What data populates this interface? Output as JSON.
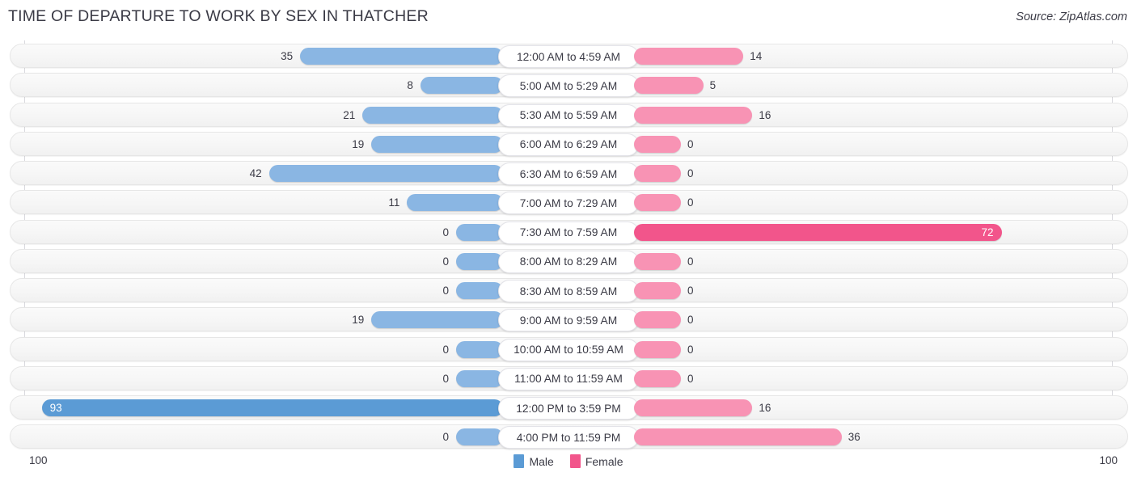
{
  "header": {
    "title": "TIME OF DEPARTURE TO WORK BY SEX IN THATCHER",
    "source": "Source: ZipAtlas.com"
  },
  "legend": {
    "male_label": "Male",
    "female_label": "Female",
    "male_color": "#5b9bd5",
    "female_color": "#f2558b"
  },
  "axis": {
    "left_max": "100",
    "right_max": "100"
  },
  "colors": {
    "male": "#8ab6e3",
    "male_highlight": "#5b9bd5",
    "female": "#f893b4",
    "female_highlight": "#f2558b",
    "track": "#f5f5f5",
    "gridline": "#d9d9de"
  },
  "chart_data": {
    "type": "bar",
    "title": "TIME OF DEPARTURE TO WORK BY SEX IN THATCHER",
    "orientation": "horizontal-diverging",
    "xlabel": "",
    "ylabel": "",
    "xlim": [
      100,
      100
    ],
    "grid": true,
    "legend_position": "bottom-center",
    "categories": [
      "12:00 AM to 4:59 AM",
      "5:00 AM to 5:29 AM",
      "5:30 AM to 5:59 AM",
      "6:00 AM to 6:29 AM",
      "6:30 AM to 6:59 AM",
      "7:00 AM to 7:29 AM",
      "7:30 AM to 7:59 AM",
      "8:00 AM to 8:29 AM",
      "8:30 AM to 8:59 AM",
      "9:00 AM to 9:59 AM",
      "10:00 AM to 10:59 AM",
      "11:00 AM to 11:59 AM",
      "12:00 PM to 3:59 PM",
      "4:00 PM to 11:59 PM"
    ],
    "series": [
      {
        "name": "Male",
        "direction": "left",
        "color": "#8ab6e3",
        "values": [
          35,
          8,
          21,
          19,
          42,
          11,
          0,
          0,
          0,
          19,
          0,
          0,
          93,
          0
        ]
      },
      {
        "name": "Female",
        "direction": "right",
        "color": "#f893b4",
        "values": [
          14,
          5,
          16,
          0,
          0,
          0,
          72,
          0,
          0,
          0,
          0,
          0,
          16,
          36
        ]
      }
    ]
  },
  "rows": [
    {
      "label": "12:00 AM to 4:59 AM",
      "male": 35,
      "female": 14,
      "male_text": "35",
      "female_text": "14"
    },
    {
      "label": "5:00 AM to 5:29 AM",
      "male": 8,
      "female": 5,
      "male_text": "8",
      "female_text": "5"
    },
    {
      "label": "5:30 AM to 5:59 AM",
      "male": 21,
      "female": 16,
      "male_text": "21",
      "female_text": "16"
    },
    {
      "label": "6:00 AM to 6:29 AM",
      "male": 19,
      "female": 0,
      "male_text": "19",
      "female_text": "0"
    },
    {
      "label": "6:30 AM to 6:59 AM",
      "male": 42,
      "female": 0,
      "male_text": "42",
      "female_text": "0"
    },
    {
      "label": "7:00 AM to 7:29 AM",
      "male": 11,
      "female": 0,
      "male_text": "11",
      "female_text": "0"
    },
    {
      "label": "7:30 AM to 7:59 AM",
      "male": 0,
      "female": 72,
      "male_text": "0",
      "female_text": "72"
    },
    {
      "label": "8:00 AM to 8:29 AM",
      "male": 0,
      "female": 0,
      "male_text": "0",
      "female_text": "0"
    },
    {
      "label": "8:30 AM to 8:59 AM",
      "male": 0,
      "female": 0,
      "male_text": "0",
      "female_text": "0"
    },
    {
      "label": "9:00 AM to 9:59 AM",
      "male": 19,
      "female": 0,
      "male_text": "19",
      "female_text": "0"
    },
    {
      "label": "10:00 AM to 10:59 AM",
      "male": 0,
      "female": 0,
      "male_text": "0",
      "female_text": "0"
    },
    {
      "label": "11:00 AM to 11:59 AM",
      "male": 0,
      "female": 0,
      "male_text": "0",
      "female_text": "0"
    },
    {
      "label": "12:00 PM to 3:59 PM",
      "male": 93,
      "female": 16,
      "male_text": "93",
      "female_text": "16"
    },
    {
      "label": "4:00 PM to 11:59 PM",
      "male": 0,
      "female": 36,
      "male_text": "0",
      "female_text": "36"
    }
  ]
}
